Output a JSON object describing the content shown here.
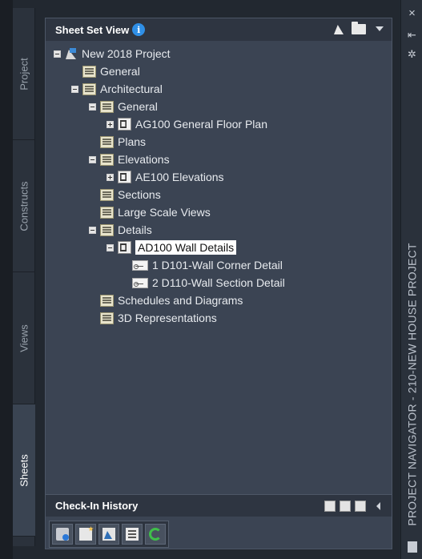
{
  "palette": {
    "title": "Sheet Set View",
    "info_icon_glyph": "i",
    "toolbar_icons": [
      "sheet-set-icon",
      "folder-icon",
      "dropdown-arrow-icon"
    ]
  },
  "side_tabs": [
    "Project",
    "Constructs",
    "Views",
    "Sheets"
  ],
  "active_tab": "Sheets",
  "tree": [
    {
      "label": "New 2018 Project",
      "icon": "sheet-set",
      "expander": "minus",
      "level": 0
    },
    {
      "label": "General",
      "icon": "subset",
      "expander": "none",
      "level": 1
    },
    {
      "label": "Architectural",
      "icon": "subset",
      "expander": "minus",
      "level": 1
    },
    {
      "label": "General",
      "icon": "subset",
      "expander": "minus",
      "level": 2
    },
    {
      "label": "AG100 General Floor Plan",
      "icon": "sheet",
      "expander": "plus",
      "level": 3
    },
    {
      "label": "Plans",
      "icon": "subset",
      "expander": "none",
      "level": 2
    },
    {
      "label": "Elevations",
      "icon": "subset",
      "expander": "minus",
      "level": 2
    },
    {
      "label": "AE100 Elevations",
      "icon": "sheet",
      "expander": "plus",
      "level": 3
    },
    {
      "label": "Sections",
      "icon": "subset",
      "expander": "none",
      "level": 2
    },
    {
      "label": "Large Scale Views",
      "icon": "subset",
      "expander": "none",
      "level": 2
    },
    {
      "label": "Details",
      "icon": "subset",
      "expander": "minus",
      "level": 2
    },
    {
      "label": "AD100 Wall Details",
      "icon": "sheet",
      "expander": "minus",
      "level": 3,
      "selected": true
    },
    {
      "label": "1 D101-Wall Corner Detail",
      "icon": "view",
      "expander": "none",
      "level": 4
    },
    {
      "label": "2 D110-Wall Section Detail",
      "icon": "view",
      "expander": "none",
      "level": 4
    },
    {
      "label": "Schedules and Diagrams",
      "icon": "subset",
      "expander": "none",
      "level": 2
    },
    {
      "label": "3D Representations",
      "icon": "subset",
      "expander": "none",
      "level": 2
    }
  ],
  "checkin": {
    "title": "Check-In History",
    "icons": [
      "checkin-history-icon",
      "list-icon",
      "view-sheet-icon"
    ]
  },
  "bottom_toolbar": [
    "publish-icon",
    "new-sheet-icon",
    "sheet-set-properties-icon",
    "properties-icon",
    "refresh-icon"
  ],
  "right_strip": {
    "close_glyph": "×",
    "pin_glyph": "⇤",
    "settings_glyph": "✲",
    "vertical_title": "PROJECT NAVIGATOR - 210-NEW HOUSE PROJECT"
  },
  "colors": {
    "panel": "#3b4453",
    "titlebar": "#2e3541",
    "info_blue": "#2f8fe6",
    "refresh_green": "#3fbf4a",
    "selection": "#ffffff"
  }
}
